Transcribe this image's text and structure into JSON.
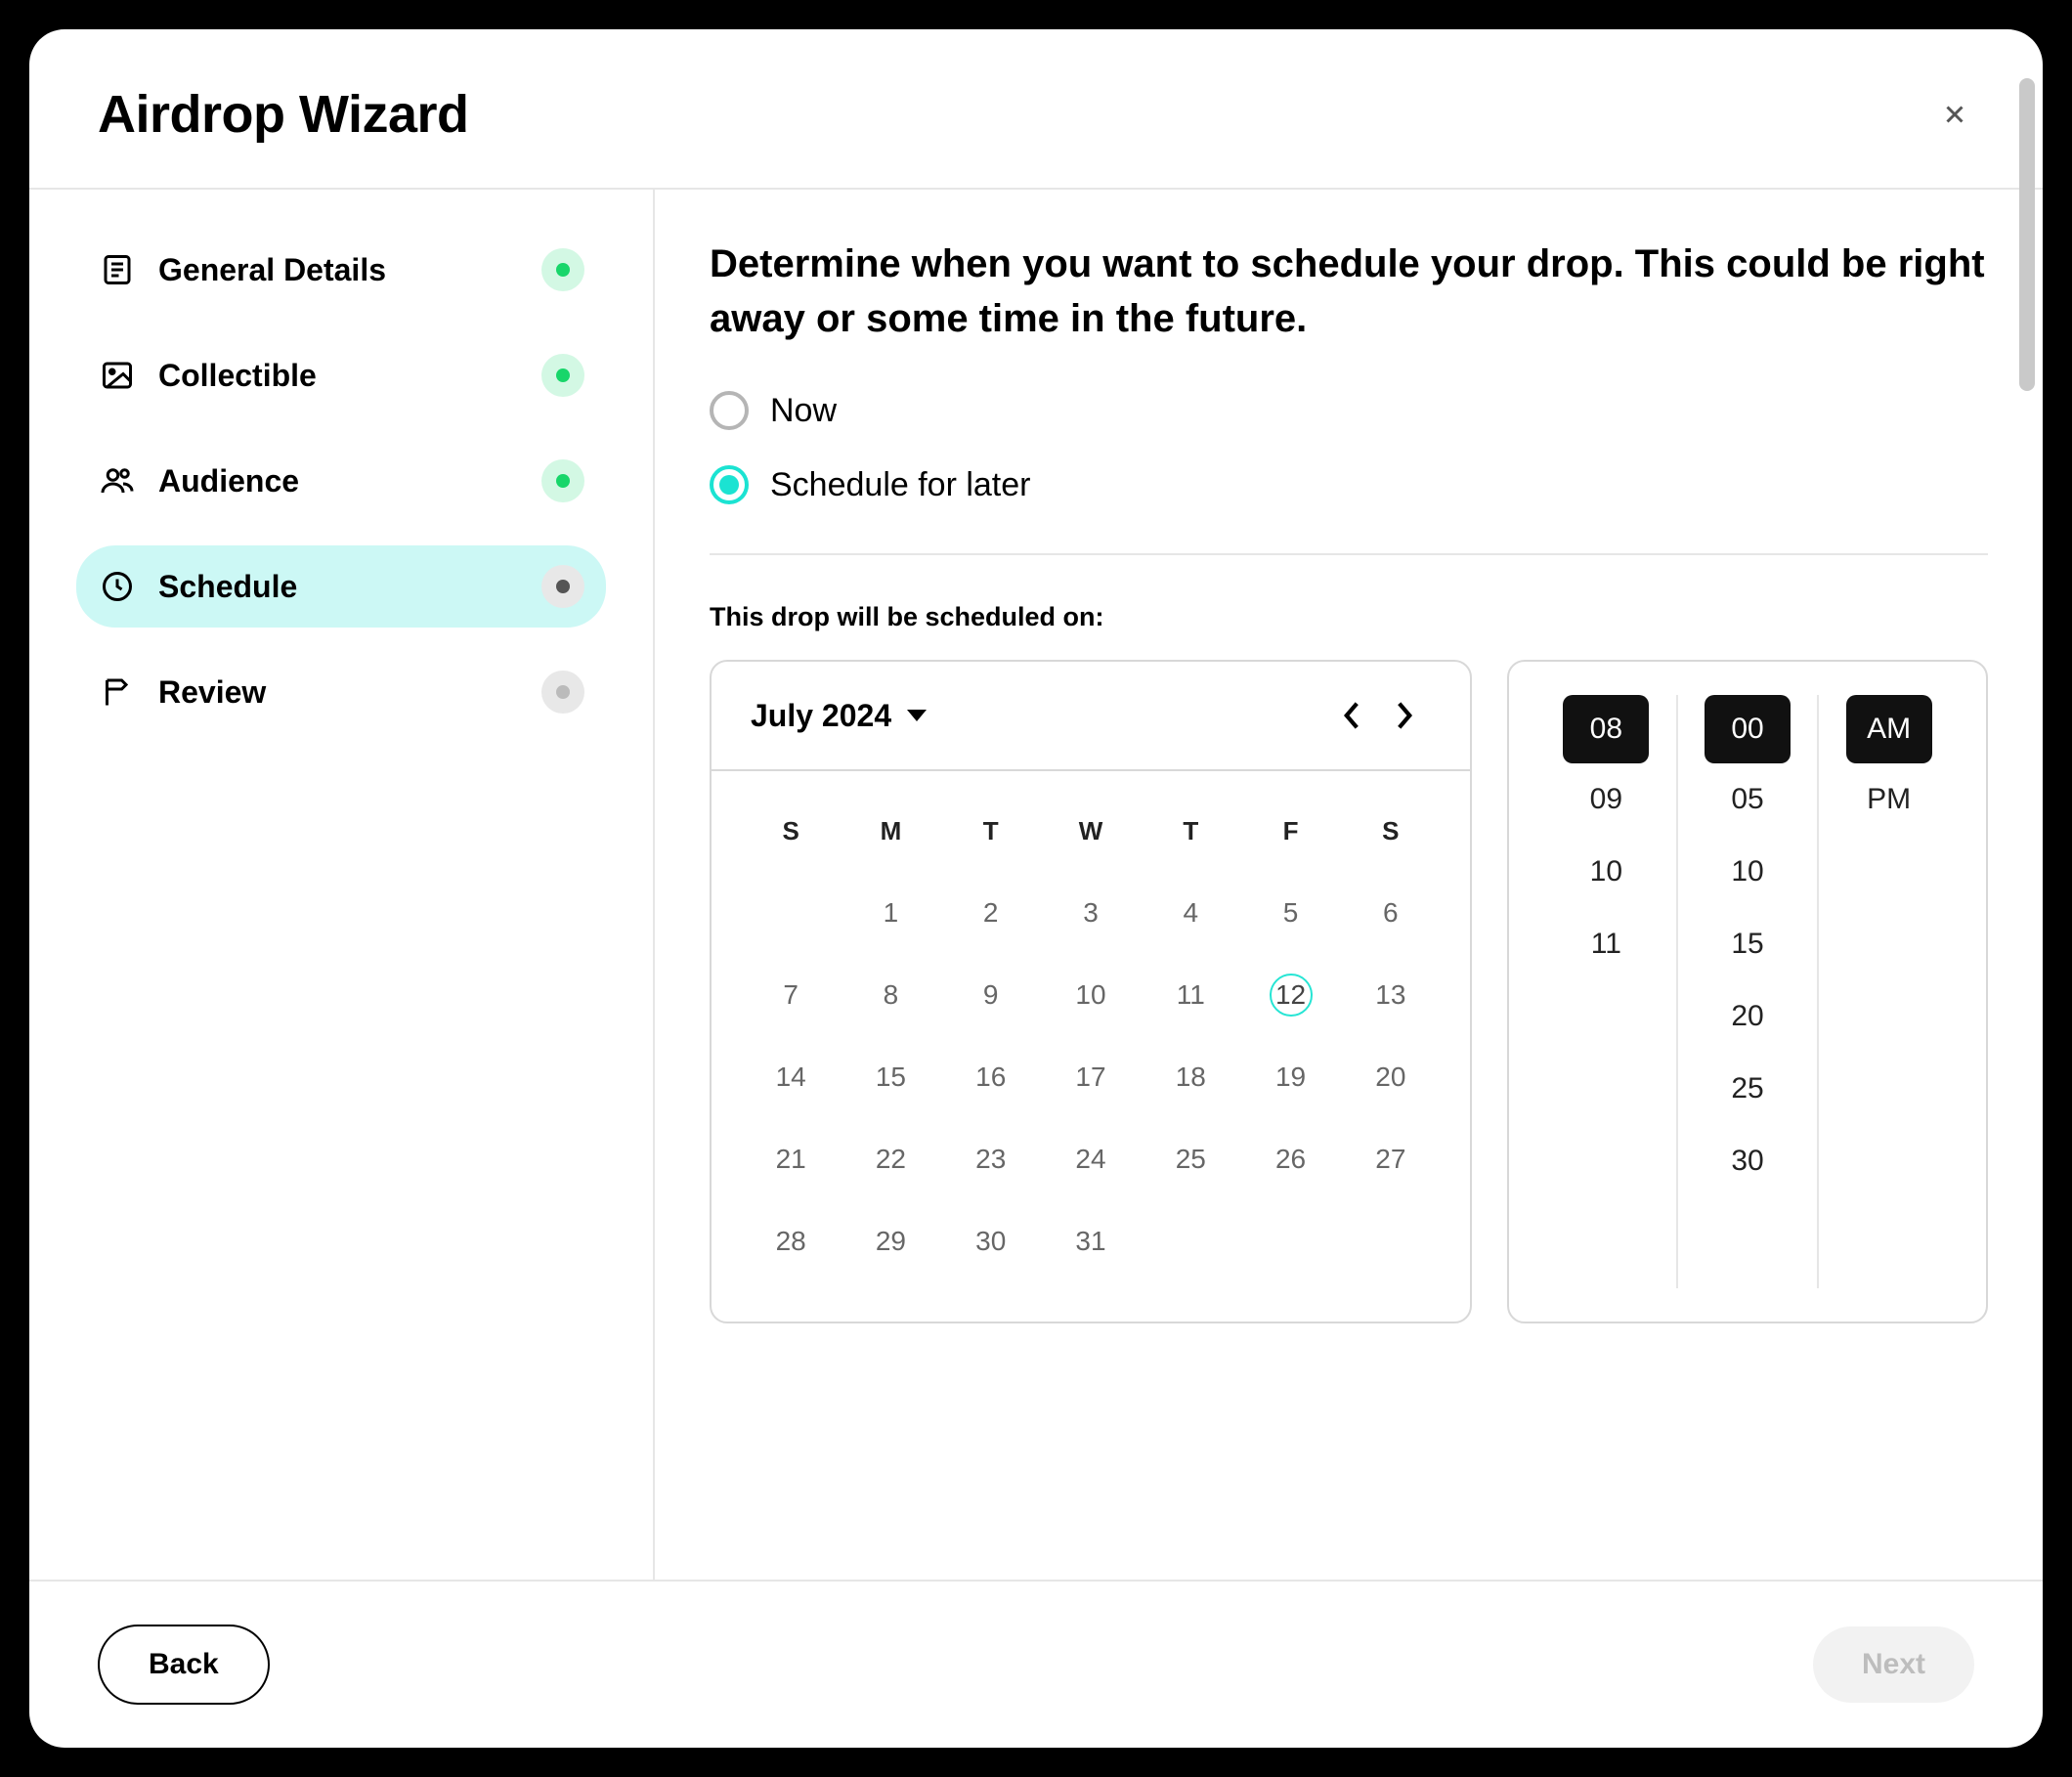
{
  "modal": {
    "title": "Airdrop Wizard"
  },
  "steps": [
    {
      "label": "General Details",
      "status": "complete"
    },
    {
      "label": "Collectible",
      "status": "complete"
    },
    {
      "label": "Audience",
      "status": "complete"
    },
    {
      "label": "Schedule",
      "status": "current"
    },
    {
      "label": "Review",
      "status": "pending"
    }
  ],
  "main": {
    "intro": "Determine when you want to schedule your drop. This could be right away or some time in the future.",
    "options": {
      "now": "Now",
      "later": "Schedule for later",
      "selected": "later"
    },
    "schedule_label": "This drop will be scheduled on:"
  },
  "calendar": {
    "month": "July 2024",
    "dow": [
      "S",
      "M",
      "T",
      "W",
      "T",
      "F",
      "S"
    ],
    "weeks": [
      [
        "",
        "1",
        "2",
        "3",
        "4",
        "5",
        "6"
      ],
      [
        "7",
        "8",
        "9",
        "10",
        "11",
        "12",
        "13"
      ],
      [
        "14",
        "15",
        "16",
        "17",
        "18",
        "19",
        "20"
      ],
      [
        "21",
        "22",
        "23",
        "24",
        "25",
        "26",
        "27"
      ],
      [
        "28",
        "29",
        "30",
        "31",
        "",
        "",
        ""
      ]
    ],
    "today": "12"
  },
  "time": {
    "hours": [
      "08",
      "09",
      "10",
      "11"
    ],
    "minutes": [
      "00",
      "05",
      "10",
      "15",
      "20",
      "25",
      "30"
    ],
    "ampm": [
      "AM",
      "PM"
    ],
    "selected": {
      "hour": "08",
      "minute": "00",
      "ampm": "AM"
    }
  },
  "footer": {
    "back": "Back",
    "next": "Next"
  }
}
